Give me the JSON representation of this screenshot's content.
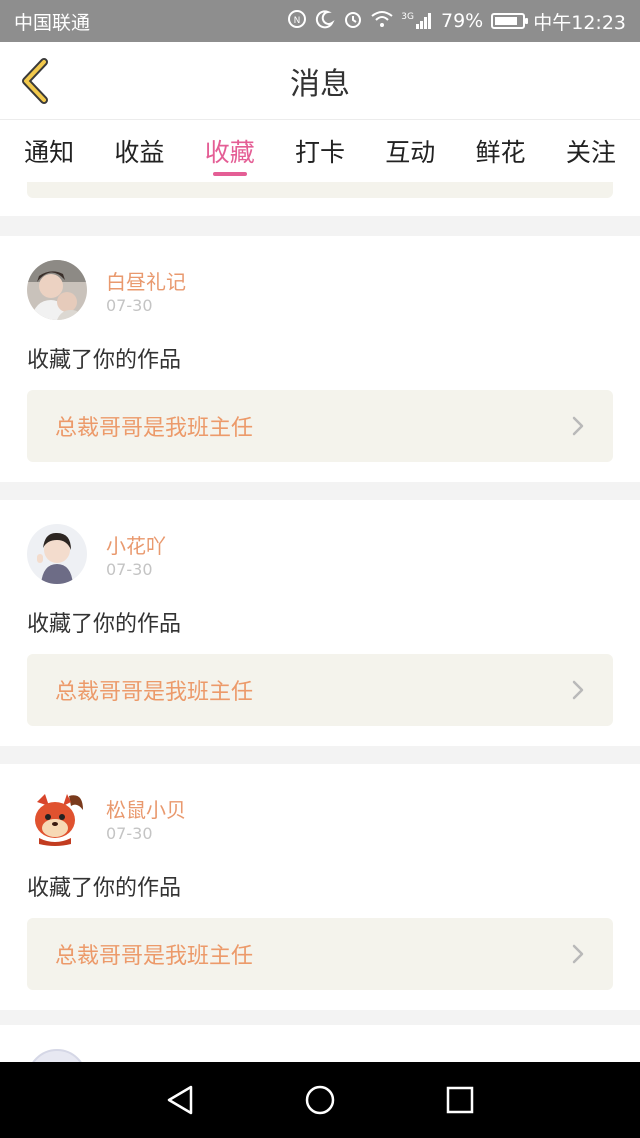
{
  "status_bar": {
    "carrier": "中国联通",
    "network": "3G",
    "battery": "79%",
    "time": "中午12:23",
    "icons": [
      "nfc-icon",
      "moon-icon",
      "alarm-icon",
      "wifi-icon",
      "signal-icon",
      "battery-icon"
    ]
  },
  "header": {
    "title": "消息",
    "back_icon": "chevron-left-icon"
  },
  "tabs": [
    {
      "label": "通知",
      "active": false
    },
    {
      "label": "收益",
      "active": false
    },
    {
      "label": "收藏",
      "active": true
    },
    {
      "label": "打卡",
      "active": false
    },
    {
      "label": "互动",
      "active": false
    },
    {
      "label": "鲜花",
      "active": false
    },
    {
      "label": "关注",
      "active": false
    }
  ],
  "messages": [
    {
      "username": "白昼礼记",
      "date": "07-30",
      "action": "收藏了你的作品",
      "work_title": "总裁哥哥是我班主任"
    },
    {
      "username": "小花吖",
      "date": "07-30",
      "action": "收藏了你的作品",
      "work_title": "总裁哥哥是我班主任"
    },
    {
      "username": "松鼠小贝",
      "date": "07-30",
      "action": "收藏了你的作品",
      "work_title": "总裁哥哥是我班主任"
    }
  ],
  "colors": {
    "accent_tab": "#e45e95",
    "username": "#e9996e",
    "work_title": "#ec9a6a",
    "back_icon": "#f2c94c"
  },
  "nav_bar": [
    "back-triangle-icon",
    "home-circle-icon",
    "recents-square-icon"
  ]
}
